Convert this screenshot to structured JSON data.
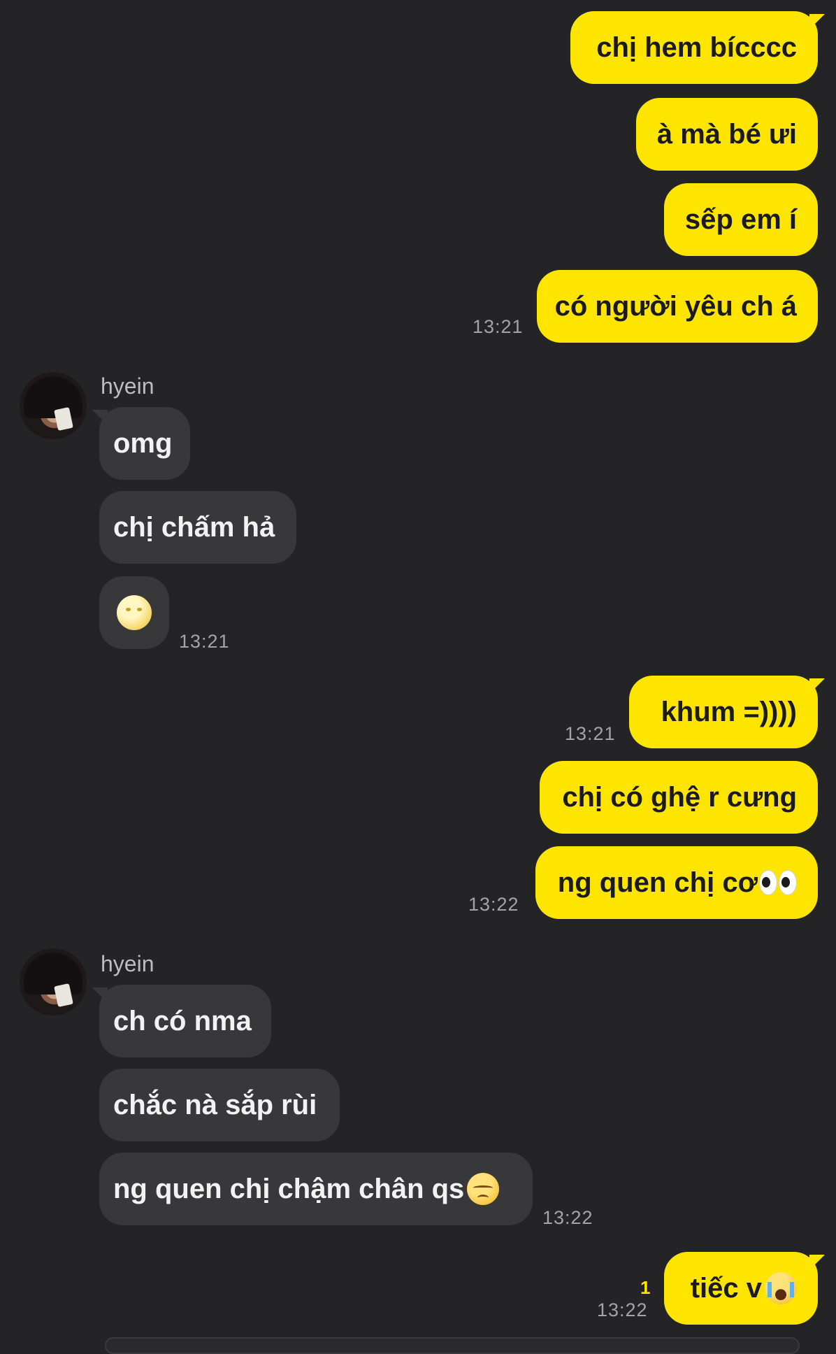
{
  "colors": {
    "background": "#242426",
    "my_bubble": "#FEE500",
    "their_bubble": "#38383b",
    "timestamp": "#a4a4a6",
    "unread": "#FEE500"
  },
  "messages": {
    "m1": {
      "text": "chị hem bícccc"
    },
    "m2": {
      "text": "à mà bé ưi"
    },
    "m3": {
      "text": "sếp em í"
    },
    "m4": {
      "text": "có người yêu ch á",
      "time": "13:21"
    },
    "sender1": {
      "name": "hyein",
      "avatar": "profile-photo"
    },
    "r1": {
      "text": "omg"
    },
    "r2": {
      "text": "chị chấm hả"
    },
    "r3": {
      "emoji": "full-moon-face",
      "time": "13:21"
    },
    "m5": {
      "text": "khum =))))",
      "time": "13:21"
    },
    "m6": {
      "text": "chị có ghệ r cưng"
    },
    "m7": {
      "text": "ng quen chị cơ",
      "emoji": "eyes",
      "time": "13:22"
    },
    "sender2": {
      "name": "hyein",
      "avatar": "profile-photo"
    },
    "r4": {
      "text": "ch có nma"
    },
    "r5": {
      "text": "chắc nà sắp rùi"
    },
    "r6": {
      "text": "ng quen chị chậm chân qs",
      "emoji": "pensive-face",
      "time": "13:22"
    },
    "m8": {
      "text": "tiếc v",
      "emoji": "loudly-crying-face",
      "unread": "1",
      "time": "13:22"
    }
  }
}
